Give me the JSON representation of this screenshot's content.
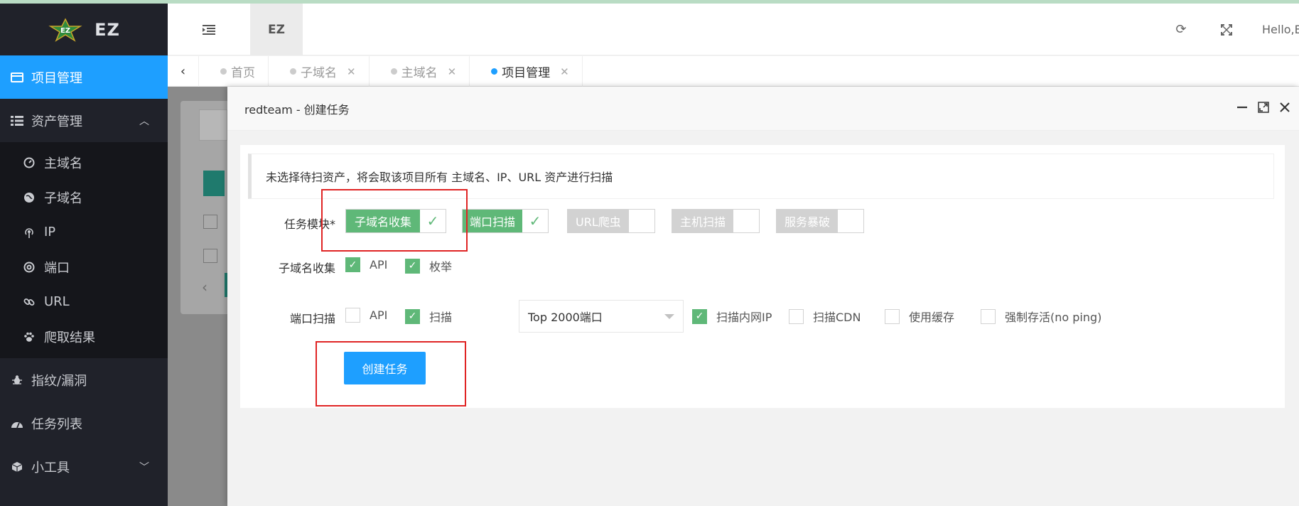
{
  "app": {
    "logo_text": "EZ",
    "logo_badge_text": "EZ"
  },
  "header": {
    "ez_label": "EZ",
    "hello": "Hello,EZ"
  },
  "sidebar": {
    "items": [
      {
        "label": "项目管理"
      },
      {
        "label": "资产管理"
      },
      {
        "label": "指纹/漏洞"
      },
      {
        "label": "任务列表"
      },
      {
        "label": "小工具"
      }
    ],
    "asset_sub": [
      {
        "label": "主域名"
      },
      {
        "label": "子域名"
      },
      {
        "label": "IP"
      },
      {
        "label": "端口"
      },
      {
        "label": "URL"
      },
      {
        "label": "爬取结果"
      }
    ]
  },
  "tabs": [
    {
      "label": "首页"
    },
    {
      "label": "子域名"
    },
    {
      "label": "主域名"
    },
    {
      "label": "项目管理"
    }
  ],
  "modal": {
    "title": "redteam - 创建任务",
    "notice": "未选择待扫资产，将会取该项目所有 主域名、IP、URL 资产进行扫描",
    "task_module_label": "任务模块*",
    "modules": [
      {
        "label": "子域名收集",
        "checked": true
      },
      {
        "label": "端口扫描",
        "checked": true
      },
      {
        "label": "URL爬虫",
        "checked": false
      },
      {
        "label": "主机扫描",
        "checked": false
      },
      {
        "label": "服务暴破",
        "checked": false
      }
    ],
    "subdomain_label": "子域名收集",
    "subdomain_options": [
      {
        "label": "API",
        "checked": true
      },
      {
        "label": "枚举",
        "checked": true
      }
    ],
    "portscan_label": "端口扫描",
    "portscan_options": [
      {
        "label": "API",
        "checked": false
      },
      {
        "label": "扫描",
        "checked": true
      }
    ],
    "port_select": "Top 2000端口",
    "extra_options": [
      {
        "label": "扫描内网IP",
        "checked": true
      },
      {
        "label": "扫描CDN",
        "checked": false
      },
      {
        "label": "使用缓存",
        "checked": false
      },
      {
        "label": "强制存活(no ping)",
        "checked": false
      }
    ],
    "create_button": "创建任务"
  },
  "colors": {
    "accent": "#1e9fff",
    "success": "#5fb878",
    "sidebar_bg": "#20222a",
    "highlight": "#e02424"
  }
}
